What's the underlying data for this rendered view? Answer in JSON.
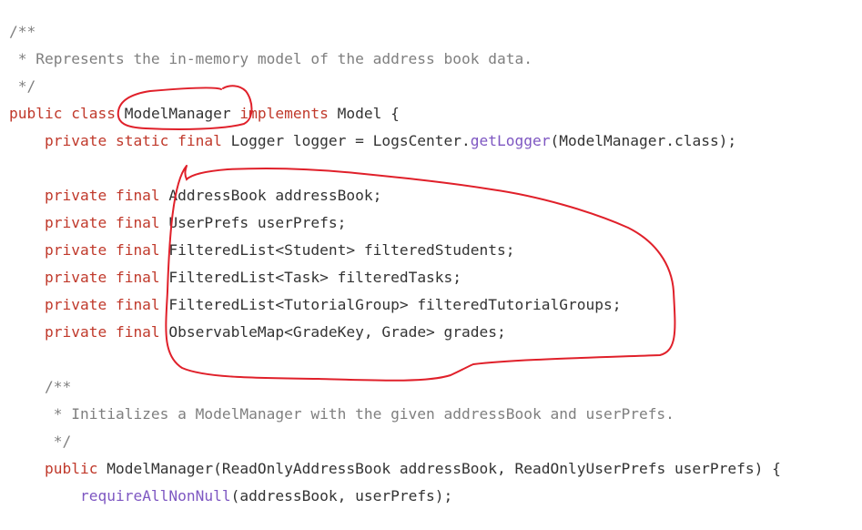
{
  "code": {
    "lines": [
      [
        {
          "t": "/**",
          "c": "cm"
        }
      ],
      [
        {
          "t": " * Represents the in-memory model of the address book data.",
          "c": "cm"
        }
      ],
      [
        {
          "t": " */",
          "c": "cm"
        }
      ],
      [
        {
          "t": "public class ",
          "c": "kw"
        },
        {
          "t": "ModelManager ",
          "c": "plain"
        },
        {
          "t": "implements",
          "c": "kw"
        },
        {
          "t": " Model {",
          "c": "plain"
        }
      ],
      [
        {
          "t": "    private static final",
          "c": "kw"
        },
        {
          "t": " Logger logger = LogsCenter.",
          "c": "plain"
        },
        {
          "t": "getLogger",
          "c": "fn"
        },
        {
          "t": "(ModelManager.class);",
          "c": "plain"
        }
      ],
      [],
      [
        {
          "t": "    private final",
          "c": "kw"
        },
        {
          "t": " AddressBook addressBook;",
          "c": "plain"
        }
      ],
      [
        {
          "t": "    private final",
          "c": "kw"
        },
        {
          "t": " UserPrefs userPrefs;",
          "c": "plain"
        }
      ],
      [
        {
          "t": "    private final",
          "c": "kw"
        },
        {
          "t": " FilteredList<Student> filteredStudents;",
          "c": "plain"
        }
      ],
      [
        {
          "t": "    private final",
          "c": "kw"
        },
        {
          "t": " FilteredList<Task> filteredTasks;",
          "c": "plain"
        }
      ],
      [
        {
          "t": "    private final",
          "c": "kw"
        },
        {
          "t": " FilteredList<TutorialGroup> filteredTutorialGroups;",
          "c": "plain"
        }
      ],
      [
        {
          "t": "    private final",
          "c": "kw"
        },
        {
          "t": " ObservableMap<GradeKey, Grade> grades;",
          "c": "plain"
        }
      ],
      [],
      [
        {
          "t": "    /**",
          "c": "cm"
        }
      ],
      [
        {
          "t": "     * Initializes a ModelManager with the given addressBook and userPrefs.",
          "c": "cm"
        }
      ],
      [
        {
          "t": "     */",
          "c": "cm"
        }
      ],
      [
        {
          "t": "    public",
          "c": "kw"
        },
        {
          "t": " ModelManager(ReadOnlyAddressBook addressBook, ReadOnlyUserPrefs userPrefs) {",
          "c": "plain"
        }
      ],
      [
        {
          "t": "        ",
          "c": "plain"
        },
        {
          "t": "requireAllNonNull",
          "c": "fn"
        },
        {
          "t": "(addressBook, userPrefs);",
          "c": "plain"
        }
      ]
    ]
  },
  "colors": {
    "keyword": "#c0392b",
    "comment": "#7f7f7f",
    "method": "#7e57c2",
    "text": "#333333",
    "annotation": "#e0202a"
  }
}
